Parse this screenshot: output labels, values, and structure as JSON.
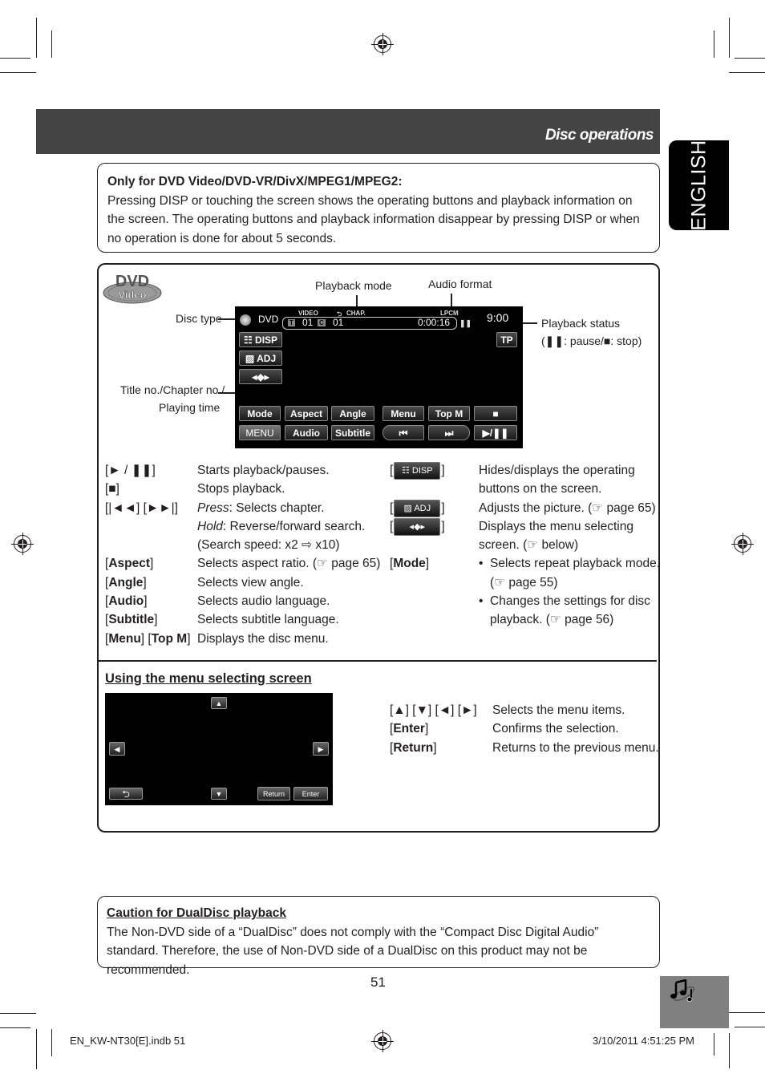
{
  "header": {
    "title": "Disc operations"
  },
  "language_tab": "ENGLISH",
  "note": {
    "title": "Only for DVD Video/DVD-VR/DivX/MPEG1/MPEG2:",
    "body": "Pressing DISP or touching the screen shows the operating buttons and playback information on the screen. The operating buttons and playback information disappear by pressing DISP or when no operation is done for about 5 seconds."
  },
  "diagram": {
    "logo": {
      "top": "DVD",
      "bottom": "Video"
    },
    "callouts": {
      "disc_type": "Disc type",
      "title_chapter_1": "Title no./Chapter no./",
      "title_chapter_2": "Playing time",
      "playback_mode": "Playback mode",
      "audio_format": "Audio format",
      "playback_status": "Playback status",
      "playback_status_note": "(❚❚: pause/■: stop)"
    },
    "screen": {
      "disc": "DVD",
      "video_label": "VIDEO",
      "mode_label": "CHAP.",
      "audio_label": "LPCM",
      "title_icon": "T",
      "title_no": "01",
      "chapter_icon": "C",
      "chapter_no": "01",
      "time": "0:00:16",
      "status": "❚❚",
      "clock": "9:00",
      "tp": "TP",
      "disp": "DISP",
      "adj": "ADJ",
      "row1": [
        "Mode",
        "Aspect",
        "Angle",
        "Menu",
        "Top M",
        "■"
      ],
      "row2": [
        "MENU",
        "Audio",
        "Subtitle",
        "⏮",
        "⏭",
        "▶/❚❚"
      ]
    }
  },
  "left_desc": [
    {
      "key": "[► / ❚❚]",
      "bold": false,
      "lines": [
        "Starts playback/pauses."
      ]
    },
    {
      "key": "[■]",
      "bold": false,
      "lines": [
        "Stops playback."
      ]
    },
    {
      "key": "[|◄◄] [►►|]",
      "bold": false,
      "lines": [
        "Press: Selects chapter.",
        "Hold: Reverse/forward search.",
        "(Search speed: x2 ⇨ x10)"
      ]
    },
    {
      "key": "Aspect",
      "bold": true,
      "lines": [
        "Selects aspect ratio. (☞ page 65)"
      ]
    },
    {
      "key": "Angle",
      "bold": true,
      "lines": [
        "Selects view angle."
      ]
    },
    {
      "key": "Audio",
      "bold": true,
      "lines": [
        "Selects audio language."
      ]
    },
    {
      "key": "Subtitle",
      "bold": true,
      "lines": [
        "Selects subtitle language."
      ]
    },
    {
      "key": "Menu] [Top M",
      "bold": true,
      "lines": [
        "Displays the disc menu."
      ]
    }
  ],
  "left_desc_text": {
    "k0": "[► / ❚❚]",
    "v0": "Starts playback/pauses.",
    "k1": "[■]",
    "v1": "Stops playback.",
    "k2": "[|◄◄] [►►|]",
    "v2a_em": "Press",
    "v2a": ": Selects chapter.",
    "v2b_em": "Hold",
    "v2b": ": Reverse/forward search.",
    "v2c": "(Search speed: x2 ⇨ x10)",
    "k3": "Aspect",
    "v3": "Selects aspect ratio. (☞ page 65)",
    "k4": "Angle",
    "v4": "Selects view angle.",
    "k5": "Audio",
    "v5": "Selects audio language.",
    "k6": "Subtitle",
    "v6": "Selects subtitle language.",
    "k7a": "Menu",
    "k7b": "Top M",
    "v7": "Displays the disc menu."
  },
  "right_desc": {
    "disp_chip": "DISP",
    "disp_1": "Hides/displays the operating",
    "disp_2": "buttons on the screen.",
    "adj_chip": "ADJ",
    "adj_1": "Adjusts the picture. (☞ page 65)",
    "arrows_1": "Displays the menu selecting",
    "arrows_2": "screen. (☞ below)",
    "mode_key": "Mode",
    "mode_b1a": "Selects repeat playback mode.",
    "mode_b1b": "(☞ page 55)",
    "mode_b2a": "Changes the settings for disc",
    "mode_b2b": "playback. (☞ page 56)"
  },
  "menu_section": {
    "heading": "Using the menu selecting screen",
    "return_btn": "Return",
    "enter_btn": "Enter",
    "items": [
      {
        "key": "[▲] [▼] [◄] [►]",
        "desc": "Selects the menu items."
      },
      {
        "key": "Enter",
        "desc": "Confirms the selection."
      },
      {
        "key": "Return",
        "desc": "Returns to the previous menu."
      }
    ]
  },
  "caution": {
    "title": "Caution for DualDisc playback",
    "body": "The Non-DVD side of a “DualDisc” does not comply with the “Compact Disc Digital Audio” standard. Therefore, the use of Non-DVD side of a DualDisc on this product may not be recommended."
  },
  "page_number": "51",
  "footer": {
    "file": "EN_KW-NT30[E].indb   51",
    "date": "3/10/2011   4:51:25 PM"
  }
}
